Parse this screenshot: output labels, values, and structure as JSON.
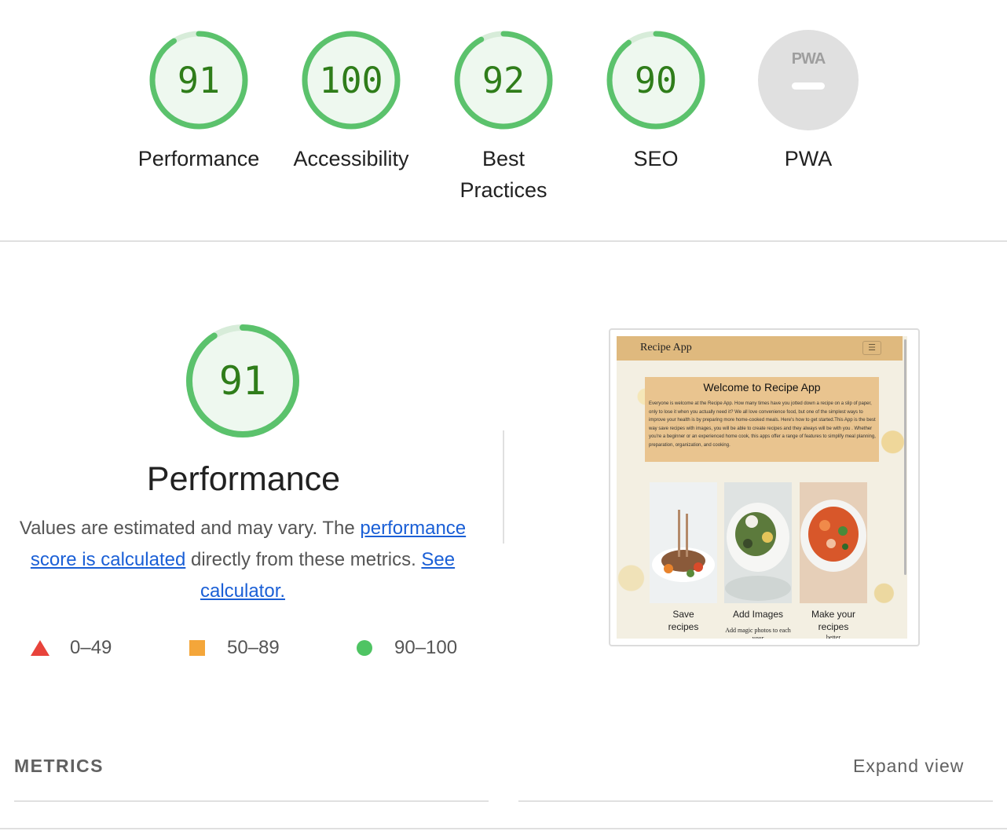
{
  "colors": {
    "pass": "#0cce6b",
    "pass_ring": "#5bc26c",
    "pass_fill": "#eef8ef",
    "pass_text": "#2f7d1a",
    "average": "#ffa400",
    "fail": "#ff4e42",
    "na": "#e0e0e0",
    "link": "#1a5fd6"
  },
  "categories": [
    {
      "label": "Performance",
      "score": "91",
      "value": 91
    },
    {
      "label": "Accessibility",
      "score": "100",
      "value": 100
    },
    {
      "label": "Best Practices",
      "label_line1": "Best",
      "label_line2": "Practices",
      "score": "92",
      "value": 92
    },
    {
      "label": "SEO",
      "score": "90",
      "value": 90
    },
    {
      "label": "PWA",
      "badge": "PWA",
      "score": "–",
      "value": null
    }
  ],
  "performance": {
    "score": "91",
    "value": 91,
    "title": "Performance",
    "desc_part1": "Values are estimated and may vary. The ",
    "desc_link1": "performance score is calculated",
    "desc_part2": " directly from these metrics. ",
    "desc_link2": "See calculator."
  },
  "legend": [
    {
      "icon": "triangle-fail-icon",
      "range": "0–49"
    },
    {
      "icon": "square-average-icon",
      "range": "50–89"
    },
    {
      "icon": "circle-pass-icon",
      "range": "90–100"
    }
  ],
  "screenshot": {
    "brand": "Recipe App",
    "menu_icon": "hamburger-icon",
    "hero_title": "Welcome to Recipe App",
    "hero_text": "Everyone is welcome at the Recipe App. How many times have you jotted down a recipe on a slip of paper, only to lose it when you actually need it? We all love convenience food, but one of the simplest ways to improve your health is by preparing more home-cooked meals. Here's how to get started.This App is the best way save recipes with images, you will be able to create recipes and they always will be with you . Whether you're a beginner or an experienced home cook, this apps offer a range of features to simplify meal planning, preparation, organization, and cooking.",
    "cards": [
      {
        "caption": "Save recipes",
        "caption_line1": "Save",
        "caption_line2": "recipes",
        "sub": ""
      },
      {
        "caption": "Add Images",
        "caption_line1": "Add Images",
        "caption_line2": "",
        "sub": "Add magic photos to each your"
      },
      {
        "caption": "Make your recipes better",
        "caption_line1": "Make your",
        "caption_line2": "recipes",
        "sub": "better"
      }
    ]
  },
  "metrics": {
    "title": "METRICS",
    "expand_label": "Expand view"
  }
}
